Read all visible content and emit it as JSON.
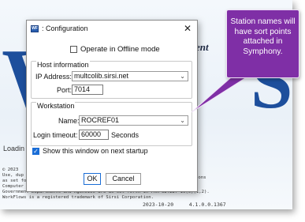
{
  "splash": {
    "big_w": "W",
    "big_s": "S",
    "tagline_fragment": "ent",
    "loading": "Loadin",
    "legal_lines": [
      "© 2023",
      "Use, dup",
      "as set fo",
      "Computer Software License in DFAR 252.227-7015. Rights for non-DOD U.S.",
      "Government Departments and Agencies are as set forth in FAR 52.227-19(c)(1,2).",
      "WorkFlows is a registered trademark of Sirsi Corporation."
    ],
    "legal_right": "ions",
    "date": "2023-10-20",
    "version": "4.1.0.0.1367"
  },
  "dialog": {
    "icon_text": "WF",
    "title": ": Configuration",
    "close_glyph": "✕",
    "offline_label": "Operate in Offline mode",
    "offline_checked": false,
    "host_group_title": "Host information",
    "ip_label": "IP Address:",
    "ip_value": "multcolib.sirsi.net",
    "port_label": "Port:",
    "port_value": "7014",
    "ws_group_title": "Workstation",
    "name_label": "Name:",
    "name_value": "ROCREF01",
    "timeout_label": "Login timeout:",
    "timeout_value": "60000",
    "timeout_unit": "Seconds",
    "startup_label": "Show this window on next startup",
    "startup_checked": true,
    "ok_label": "OK",
    "cancel_label": "Cancel",
    "chevron_glyph": "⌄",
    "check_glyph": "✓"
  },
  "callout": {
    "text": "Station names will have sort points attached in Symphony.",
    "color": "#7f2fa6"
  }
}
